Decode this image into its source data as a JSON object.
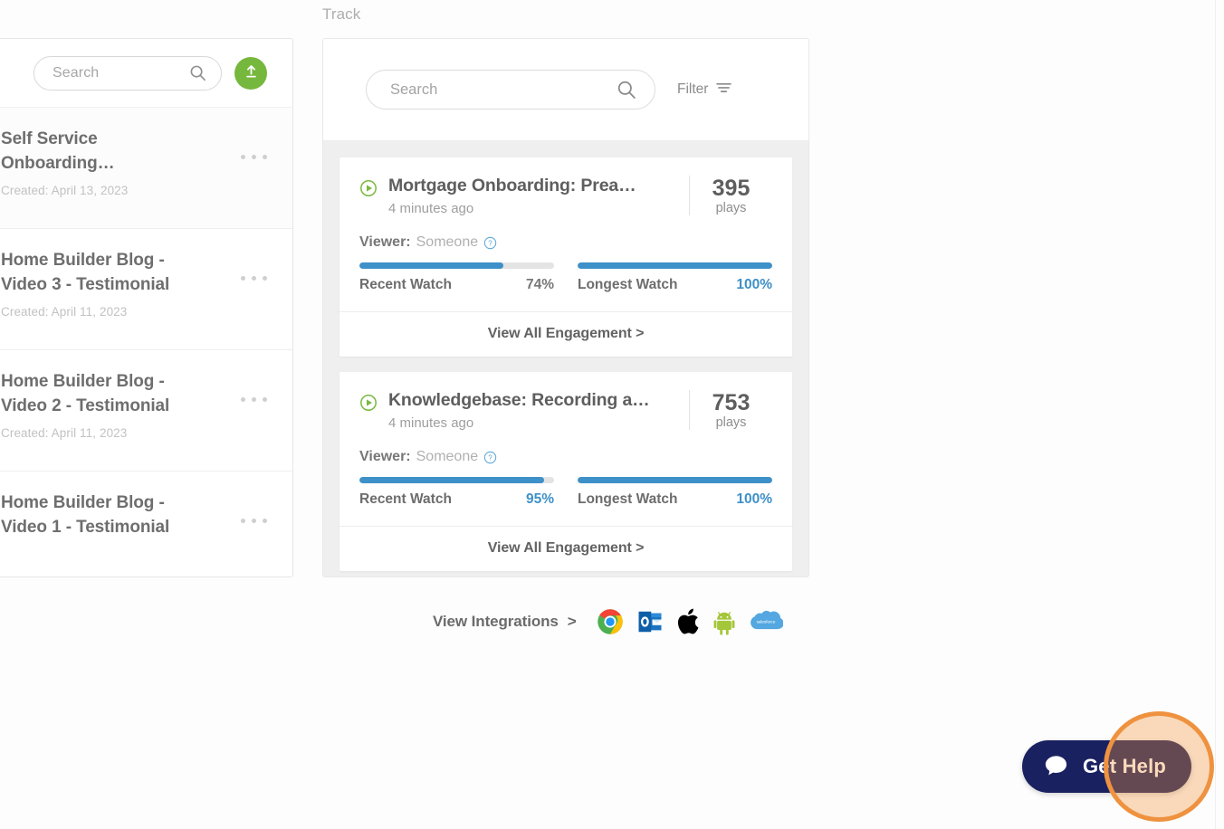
{
  "library": {
    "search": {
      "placeholder": "Search",
      "icon": "search-icon"
    },
    "upload_button": {
      "icon": "upload-icon"
    },
    "items": [
      {
        "title": "Self Service Onboarding…",
        "created": "Created: April 13, 2023"
      },
      {
        "title": "Home Builder Blog - Video 3 - Testimonial",
        "created": "Created: April 11, 2023"
      },
      {
        "title": "Home Builder Blog - Video 2 - Testimonial",
        "created": "Created: April 11, 2023"
      },
      {
        "title": "Home Builder Blog - Video 1 - Testimonial",
        "created": ""
      }
    ]
  },
  "track": {
    "label": "Track",
    "search": {
      "placeholder": "Search",
      "icon": "search-icon"
    },
    "filter": {
      "label": "Filter",
      "icon": "filter-icon"
    },
    "cards": [
      {
        "title": "Mortgage Onboarding: Prea…",
        "time": "4 minutes ago",
        "plays_count": "395",
        "plays_label": "plays",
        "viewer_key": "Viewer:",
        "viewer_value": "Someone",
        "recent_watch_label": "Recent Watch",
        "recent_watch_value": "74%",
        "recent_watch_pct": 74,
        "longest_watch_label": "Longest Watch",
        "longest_watch_value": "100%",
        "longest_watch_pct": 100,
        "footer": "View All Engagement >"
      },
      {
        "title": "Knowledgebase: Recording a…",
        "time": "4 minutes ago",
        "plays_count": "753",
        "plays_label": "plays",
        "viewer_key": "Viewer:",
        "viewer_value": "Someone",
        "recent_watch_label": "Recent Watch",
        "recent_watch_value": "95%",
        "recent_watch_pct": 95,
        "longest_watch_label": "Longest Watch",
        "longest_watch_value": "100%",
        "longest_watch_pct": 100,
        "footer": "View All Engagement >"
      }
    ]
  },
  "integrations": {
    "link_label": "View Integrations",
    "chevron": ">",
    "icons": [
      "chrome-icon",
      "outlook-icon",
      "apple-icon",
      "android-icon",
      "salesforce-icon"
    ]
  },
  "get_help": {
    "label": "Get Help",
    "icon": "chat-bubble-icon"
  },
  "colors": {
    "accent_green": "#76b73d",
    "progress_blue": "#3e90c8",
    "help_navy": "#1a2160",
    "highlight_orange": "#ef9240"
  }
}
